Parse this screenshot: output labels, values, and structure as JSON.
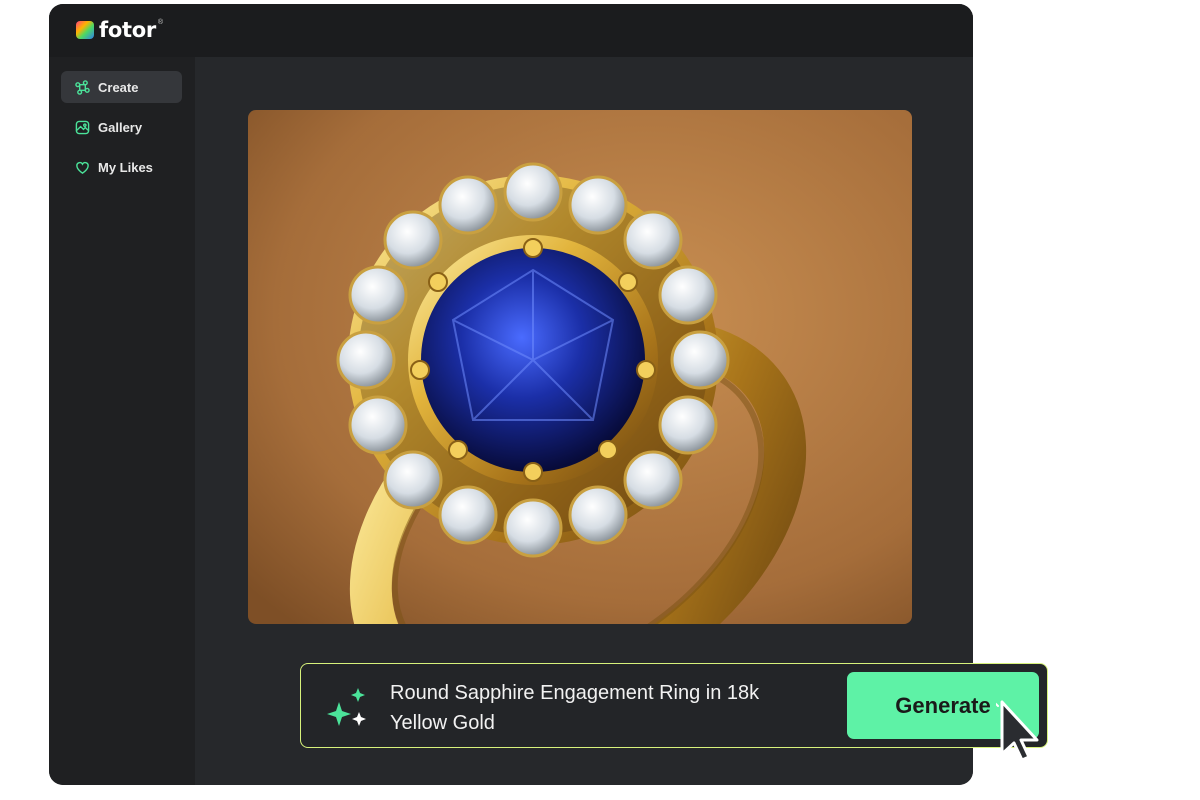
{
  "app": {
    "logo_text": "fotor",
    "logo_mark": "®"
  },
  "sidebar": {
    "items": [
      {
        "label": "Create",
        "icon": "command-icon",
        "active": true
      },
      {
        "label": "Gallery",
        "icon": "image-icon",
        "active": false
      },
      {
        "label": "My Likes",
        "icon": "heart-icon",
        "active": false
      }
    ]
  },
  "result": {
    "image": "generated-ring-image"
  },
  "prompt": {
    "text": "Round Sapphire Engagement Ring in 18k Yellow Gold",
    "icon": "sparkle-icon"
  },
  "actions": {
    "generate_label": "Generate"
  },
  "colors": {
    "accent": "#5ef2a6",
    "prompt_border": "#d7f27b",
    "icon_green": "#4be39a",
    "sidebar_bg": "#1f2022",
    "panel_bg": "#26282b"
  }
}
